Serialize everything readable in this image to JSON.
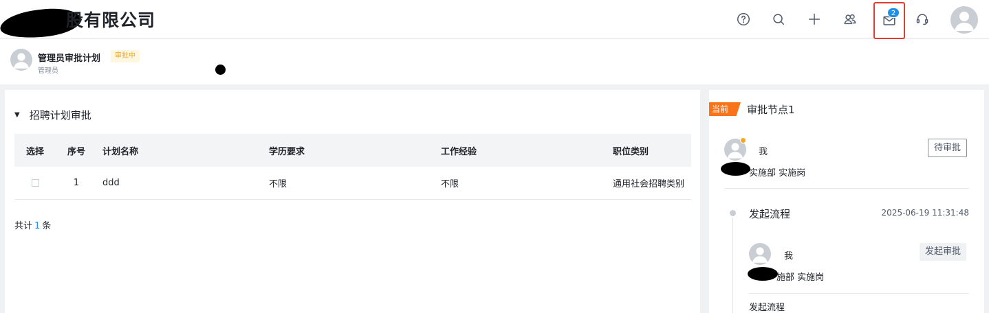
{
  "header": {
    "company_name": "股有限公司",
    "icons": [
      "help-icon",
      "search-icon",
      "add-icon",
      "contacts-icon",
      "mail-icon",
      "headset-icon"
    ],
    "mail_badge": "2"
  },
  "subheader": {
    "plan_title": "管理员审批计划",
    "status": "审批中",
    "applicant": "管理员"
  },
  "section": {
    "title": "招聘计划审批",
    "columns": [
      "选择",
      "序号",
      "计划名称",
      "学历要求",
      "工作经验",
      "职位类别"
    ],
    "rows": [
      {
        "no": "1",
        "name": "ddd",
        "education": "不限",
        "experience": "不限",
        "category": "通用社会招聘类别"
      }
    ],
    "total_prefix": "共计",
    "total_count": "1",
    "total_suffix": "条"
  },
  "approval": {
    "current_tag": "当前",
    "node_title": "审批节点1",
    "approver": "我",
    "approver_dept": "实施部 实施岗",
    "pending_label": "待审批",
    "flow_title": "发起流程",
    "flow_time": "2025-06-19 11:31:48",
    "initiator": "我",
    "initiator_dept": "施部 实施岗",
    "launch_label": "发起审批",
    "flow_footer": "发起流程"
  },
  "colors": {
    "accent": "#1e90e6",
    "current_tag": "#f7741b",
    "status_tag_text": "#f5a623",
    "highlight_border": "#e23a2f"
  }
}
